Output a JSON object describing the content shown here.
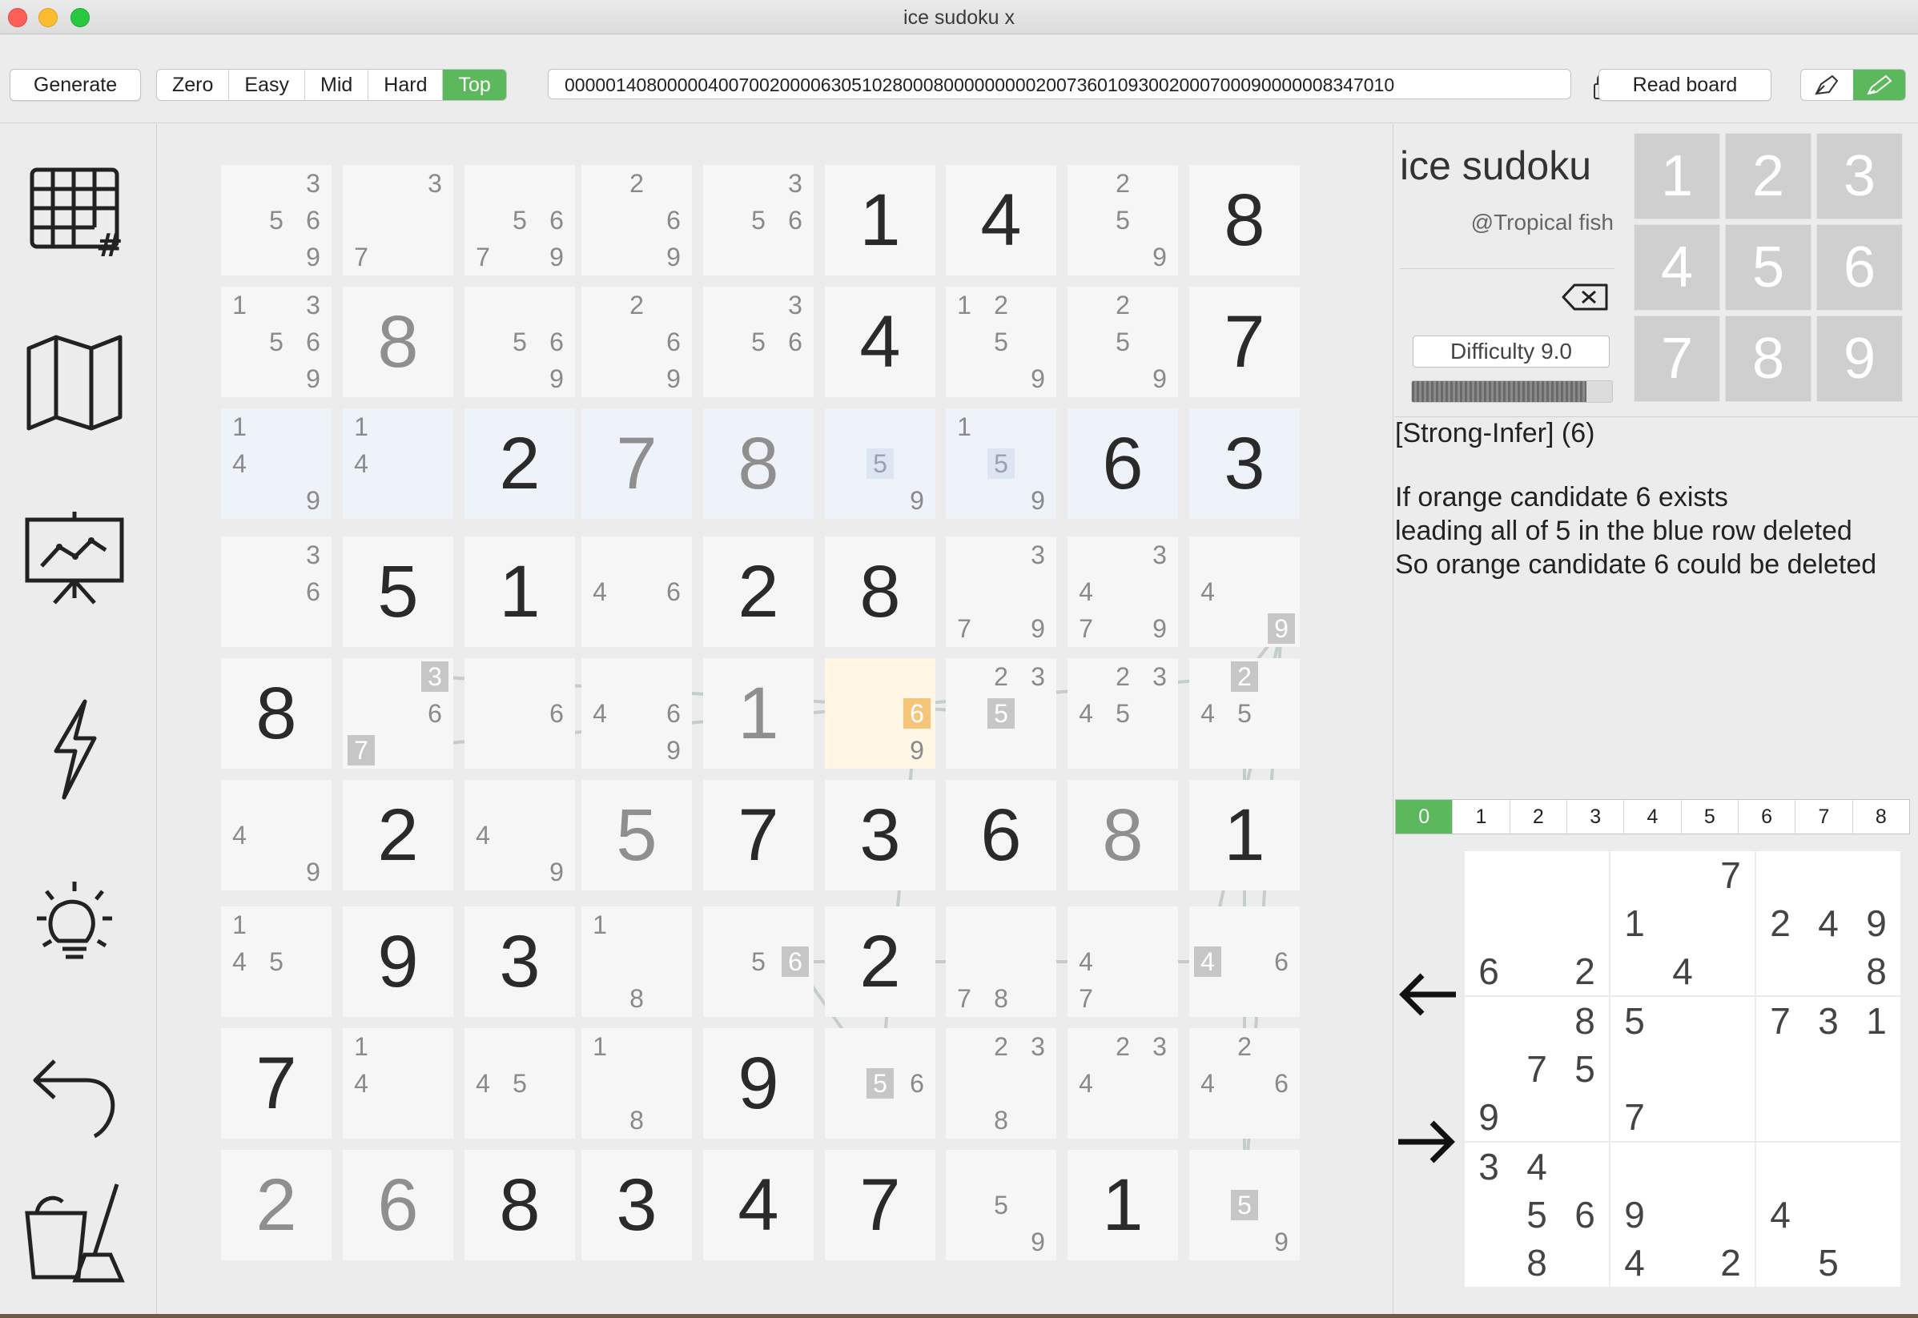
{
  "window": {
    "title": "ice sudoku x"
  },
  "toolbar": {
    "generate_label": "Generate",
    "levels": [
      {
        "label": "Zero",
        "active": false
      },
      {
        "label": "Easy",
        "active": false
      },
      {
        "label": "Mid",
        "active": false
      },
      {
        "label": "Hard",
        "active": false
      },
      {
        "label": "Top",
        "active": true
      }
    ],
    "puzzle_string": "000001408000004007002000063051028000800000000020073601093002000700090000008347010",
    "read_board_label": "Read board",
    "accent_color": "#5cb85c"
  },
  "sidebar": {
    "icons": [
      "grid-icon",
      "map-icon",
      "chart-presentation-icon",
      "lightning-icon",
      "lightbulb-icon",
      "undo-icon",
      "clean-icon"
    ]
  },
  "board": {
    "givens": [
      [
        0,
        0,
        0,
        0,
        0,
        1,
        4,
        0,
        8
      ],
      [
        0,
        8,
        0,
        0,
        0,
        4,
        0,
        0,
        7
      ],
      [
        0,
        0,
        2,
        7,
        8,
        0,
        0,
        6,
        3
      ],
      [
        0,
        5,
        1,
        0,
        2,
        8,
        0,
        0,
        0
      ],
      [
        8,
        0,
        0,
        0,
        1,
        0,
        0,
        0,
        0
      ],
      [
        0,
        2,
        0,
        5,
        7,
        3,
        6,
        8,
        1
      ],
      [
        0,
        9,
        3,
        0,
        0,
        2,
        0,
        0,
        0
      ],
      [
        7,
        0,
        0,
        0,
        9,
        0,
        0,
        0,
        0
      ],
      [
        2,
        6,
        8,
        3,
        4,
        7,
        0,
        1,
        0
      ]
    ],
    "solved_cells": [
      [
        1,
        1
      ],
      [
        2,
        3
      ],
      [
        2,
        4
      ],
      [
        4,
        4
      ],
      [
        5,
        3
      ],
      [
        5,
        7
      ],
      [
        8,
        0
      ],
      [
        8,
        1
      ]
    ],
    "candidates": {
      "0-0": [
        3,
        5,
        6,
        9
      ],
      "0-1": [
        3,
        7
      ],
      "0-2": [
        5,
        6,
        7,
        9
      ],
      "0-3": [
        2,
        6,
        9
      ],
      "0-4": [
        3,
        5,
        6
      ],
      "0-7": [
        2,
        5,
        9
      ],
      "1-0": [
        1,
        3,
        5,
        6,
        9
      ],
      "1-2": [
        5,
        6,
        9
      ],
      "1-3": [
        2,
        6,
        9
      ],
      "1-4": [
        3,
        5,
        6
      ],
      "1-6": [
        1,
        2,
        5,
        9
      ],
      "1-7": [
        2,
        5,
        9
      ],
      "2-0": [
        1,
        4,
        9
      ],
      "2-1": [
        1,
        4
      ],
      "2-5": [
        5,
        9
      ],
      "2-6": [
        1,
        5,
        9
      ],
      "3-0": [
        3,
        6
      ],
      "3-3": [
        4,
        6
      ],
      "3-6": [
        3,
        7,
        9
      ],
      "3-7": [
        3,
        4,
        7,
        9
      ],
      "3-8": [
        4,
        9
      ],
      "4-1": [
        3,
        6,
        7
      ],
      "4-2": [
        6
      ],
      "4-3": [
        4,
        6,
        9
      ],
      "4-5": [
        6,
        9
      ],
      "4-6": [
        2,
        3,
        5
      ],
      "4-7": [
        2,
        3,
        4,
        5
      ],
      "4-8": [
        2,
        4,
        5
      ],
      "5-0": [
        4,
        9
      ],
      "5-2": [
        4,
        9
      ],
      "6-0": [
        1,
        4,
        5
      ],
      "6-3": [
        1,
        8
      ],
      "6-4": [
        5,
        6
      ],
      "6-6": [
        7,
        8
      ],
      "6-7": [
        4,
        7
      ],
      "6-8": [
        4,
        6
      ],
      "7-1": [
        1,
        4
      ],
      "7-2": [
        4,
        5
      ],
      "7-3": [
        1,
        8
      ],
      "7-5": [
        5,
        6
      ],
      "7-6": [
        2,
        3,
        8
      ],
      "7-7": [
        2,
        3,
        4
      ],
      "7-8": [
        2,
        4,
        6
      ],
      "8-6": [
        5,
        9
      ],
      "8-8": [
        5,
        9
      ]
    },
    "marked_candidates": [
      "4-1-3",
      "4-1-7",
      "4-6-5",
      "4-8-2",
      "3-8-9",
      "6-4-6",
      "6-8-4",
      "7-5-5",
      "8-8-5"
    ],
    "blue_marked": [
      "2-5-5",
      "2-6-5"
    ],
    "orange_marked": [
      "4-5-6"
    ],
    "highlight_row": 2,
    "highlight_cell": "4-5"
  },
  "panel": {
    "app_name": "ice sudoku",
    "author": "@Tropical fish",
    "difficulty": "Difficulty 9.0",
    "difficulty_progress": 0.87,
    "numpad": [
      "1",
      "2",
      "3",
      "4",
      "5",
      "6",
      "7",
      "8",
      "9"
    ],
    "hint_title": "[Strong-Infer] (6)",
    "hint_lines": [
      "If orange candidate 6 exists",
      "leading all of 5 in the blue row deleted",
      "So orange candidate 6 could be deleted"
    ],
    "steps": [
      "0",
      "1",
      "2",
      "3",
      "4",
      "5",
      "6",
      "7",
      "8"
    ],
    "active_step": 0
  },
  "mini_board": {
    "values": [
      [
        0,
        0,
        0,
        0,
        0,
        7,
        0,
        0,
        0
      ],
      [
        0,
        0,
        0,
        1,
        0,
        0,
        2,
        4,
        9
      ],
      [
        6,
        0,
        2,
        0,
        4,
        0,
        0,
        0,
        8
      ],
      [
        0,
        0,
        8,
        5,
        0,
        0,
        7,
        3,
        1
      ],
      [
        0,
        7,
        5,
        0,
        0,
        0,
        0,
        0,
        0
      ],
      [
        9,
        0,
        0,
        7,
        0,
        0,
        0,
        0,
        0
      ],
      [
        3,
        4,
        0,
        0,
        0,
        0,
        0,
        0,
        0
      ],
      [
        0,
        5,
        6,
        9,
        0,
        0,
        4,
        0,
        0
      ],
      [
        0,
        8,
        0,
        4,
        0,
        2,
        0,
        5,
        0
      ]
    ]
  }
}
